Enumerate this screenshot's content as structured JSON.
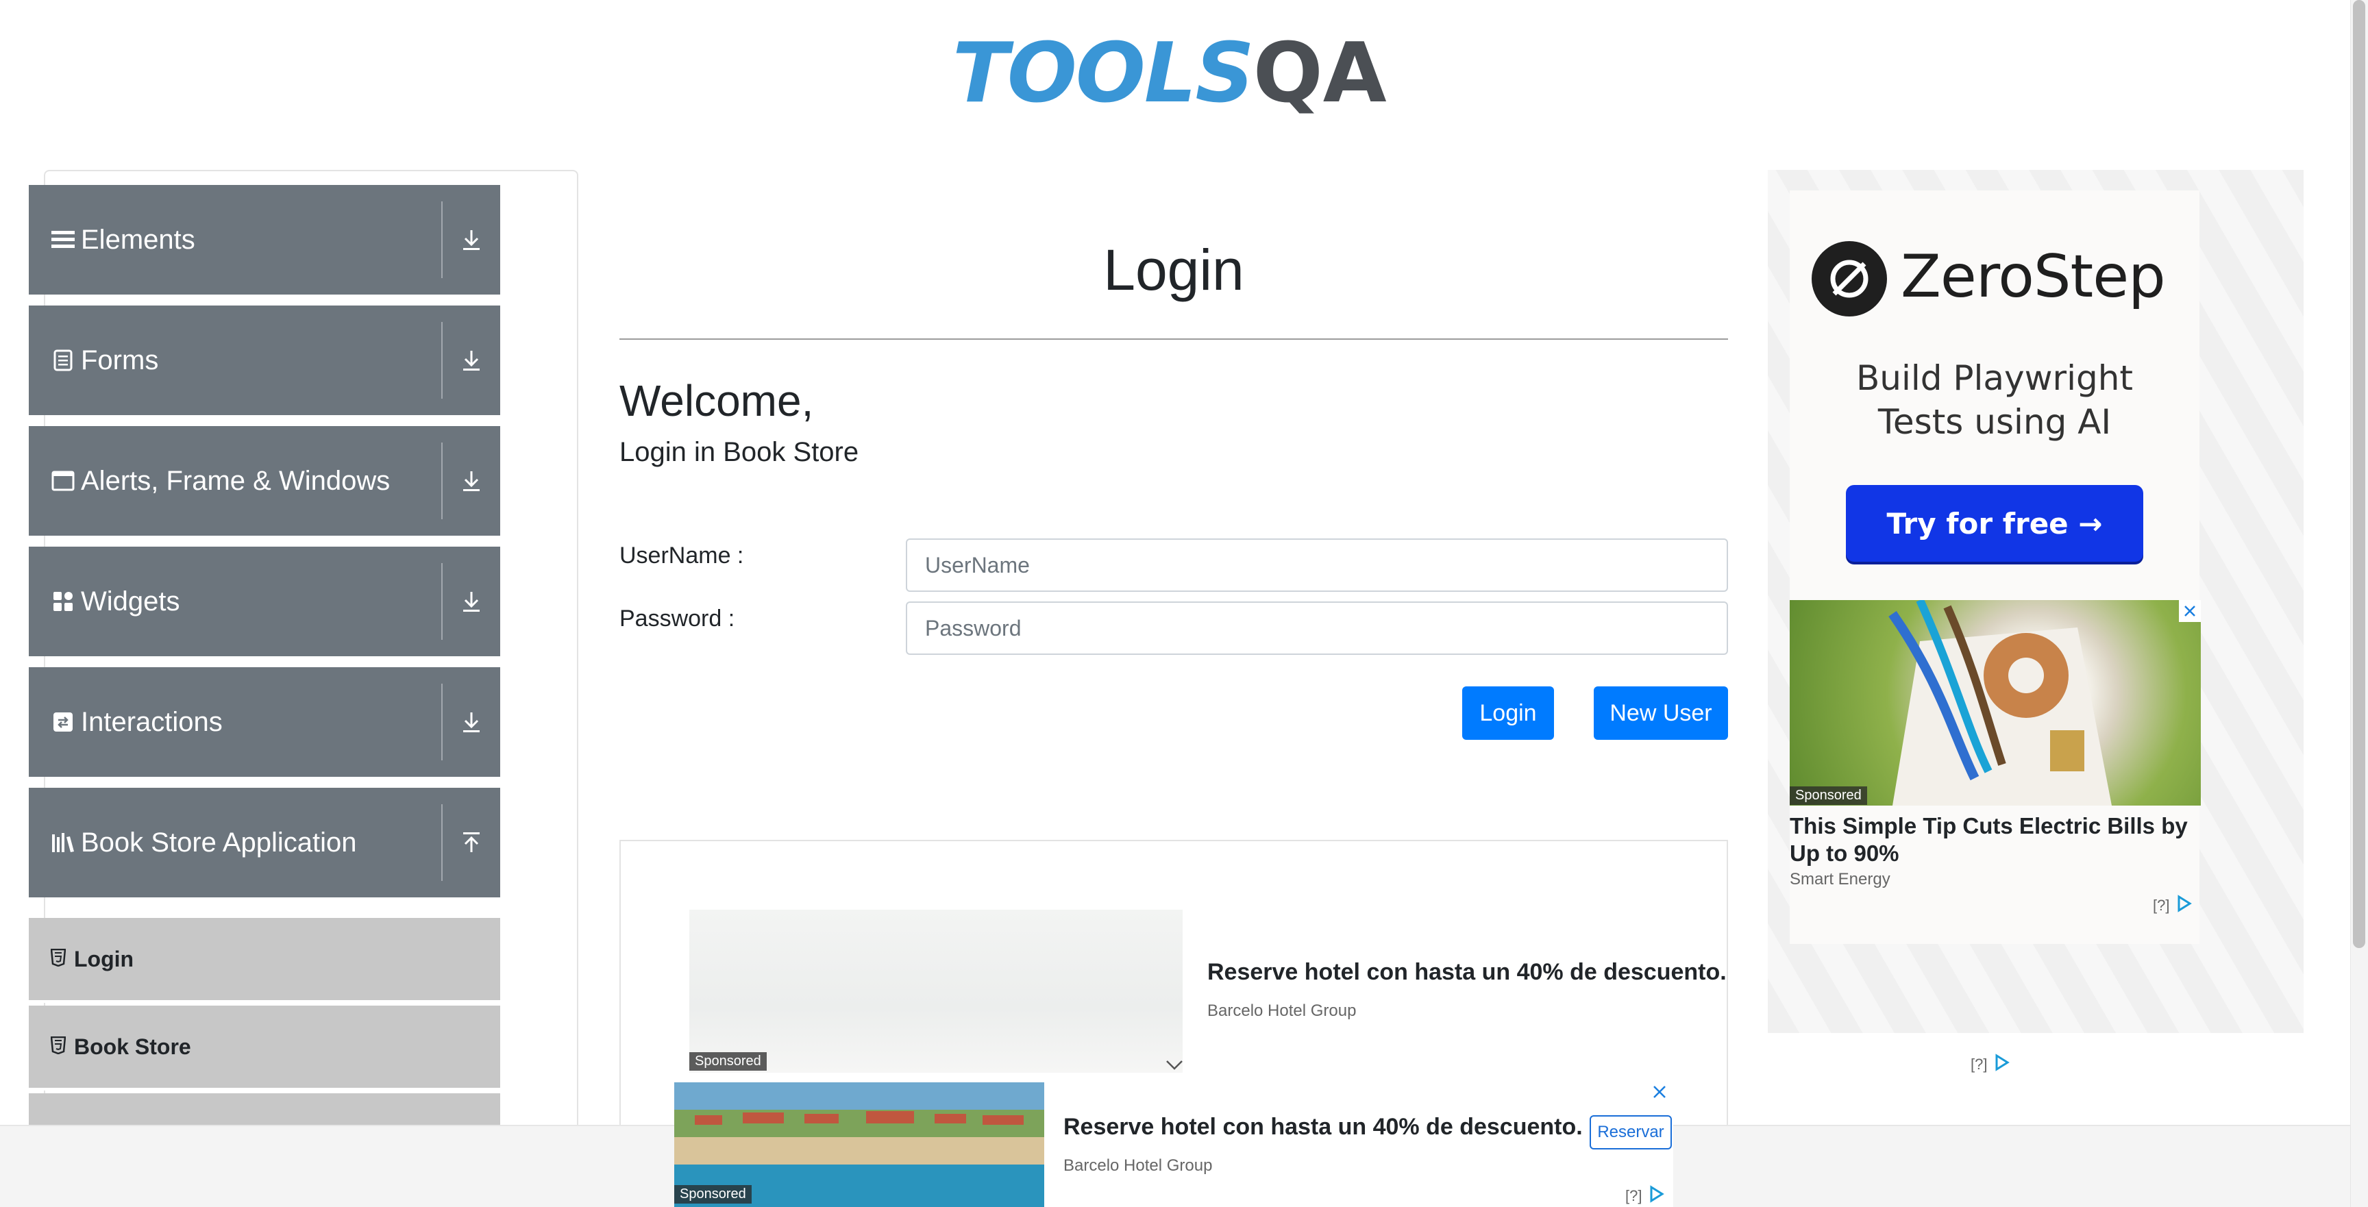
{
  "header": {
    "logo_text_a": "TOOLS",
    "logo_text_b": "QA"
  },
  "sidebar": {
    "groups": [
      {
        "label": "Elements",
        "icon": "menu-lines-icon",
        "state": "collapsed"
      },
      {
        "label": "Forms",
        "icon": "document-icon",
        "state": "collapsed"
      },
      {
        "label": "Alerts, Frame & Windows",
        "icon": "window-icon",
        "state": "collapsed"
      },
      {
        "label": "Widgets",
        "icon": "widgets-grid-icon",
        "state": "collapsed"
      },
      {
        "label": "Interactions",
        "icon": "interactions-icon",
        "state": "collapsed"
      },
      {
        "label": "Book Store Application",
        "icon": "books-icon",
        "state": "expanded"
      }
    ],
    "book_store_items": [
      {
        "label": "Login",
        "icon": "html5-icon",
        "active": true
      },
      {
        "label": "Book Store",
        "icon": "html5-icon",
        "active": false
      }
    ]
  },
  "main": {
    "page_title": "Login",
    "welcome": "Welcome,",
    "subtitle": "Login in Book Store",
    "username_label": "UserName :",
    "username_placeholder": "UserName",
    "username_value": "",
    "password_label": "Password :",
    "password_placeholder": "Password",
    "password_value": "",
    "login_button": "Login",
    "new_user_button": "New User"
  },
  "ads": {
    "main_ad": {
      "title": "Reserve hotel con hasta un 40% de descuento.",
      "brand": "Barcelo Hotel Group",
      "sponsored": "Sponsored"
    },
    "right_ad": {
      "brand": "ZeroStep",
      "tagline_line1": "Build Playwright",
      "tagline_line2": "Tests using AI",
      "cta": "Try for free →",
      "native_title": "This Simple Tip Cuts Electric Bills by Up to 90%",
      "native_brand": "Smart Energy",
      "sponsored": "Sponsored",
      "adchoices": "[?]"
    },
    "bottom_ad": {
      "title": "Reserve hotel con hasta un 40% de descuento.",
      "brand": "Barcelo Hotel Group",
      "button": "Reservar",
      "sponsored": "Sponsored",
      "adchoices": "[?]"
    },
    "below_right_adchoices": "[?]"
  },
  "colors": {
    "sidebar_group_bg": "#6c757d",
    "sidebar_item_bg": "#c7c7c7",
    "primary_button": "#007bff",
    "logo_blue": "#3a96d6",
    "logo_gray": "#4b4f54",
    "zerostep_cta": "#1136e6"
  }
}
